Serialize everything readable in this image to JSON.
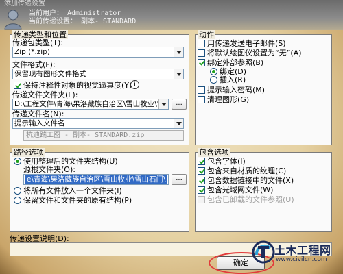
{
  "window": {
    "title": "添加传递设置",
    "user_line": "当前用户：  Administrator",
    "setting_line": "当前传递设置：  副本- STANDARD"
  },
  "transmittal_type": {
    "group_title": "传递类型和位置",
    "package_type_label": "传递包类型(T):",
    "package_type_value": "Zip (*.zip)",
    "file_format_label": "文件格式(F):",
    "file_format_value": "保留现有图形文件格式",
    "keep_visual_fidelity_label": "保持注释性对象的视觉逼真度(Y)",
    "folder_label": "传递文件文件夹(L):",
    "folder_value": "D:\\工程文件\\青海\\果洛藏族自治区\\雪山牧业\\雪山石",
    "folder_browse": "...",
    "filename_label": "传递文件名(N):",
    "filename_value": "提示输入文件名",
    "filename_preview": "杭迪踹工图 - 副本- STANDARD.zip"
  },
  "actions": {
    "group_title": "动作",
    "items": [
      {
        "label": "用传递发送电子邮件(S)",
        "checked": false
      },
      {
        "label": "将默认绘图仪设置为“无”(A)",
        "checked": false
      },
      {
        "label": "绑定外部参照(B)",
        "checked": true
      },
      {
        "label": "提示输入密码(M)",
        "checked": false
      },
      {
        "label": "清理图形(G)",
        "checked": false
      }
    ],
    "bind_label": "绑定(D)",
    "insert_label": "插入(R)"
  },
  "path_options": {
    "group_title": "路径选项",
    "use_organized_label": "使用整理后的文件夹结构(U)",
    "source_root_label": "源根文件夹(O):",
    "source_root_value": "e\\青海\\果洛藏族自治区\\雪山牧业\\雪山石门\\",
    "source_browse": "...",
    "all_in_one_label": "将所有文件放入一个文件夹(I)",
    "keep_structure_label": "保留文件和文件夹的原有结构(P)"
  },
  "include_options": {
    "group_title": "包含选项",
    "items": [
      {
        "label": "包含字体(I)",
        "checked": true,
        "disabled": false
      },
      {
        "label": "包含来自材质的纹理(C)",
        "checked": true,
        "disabled": false
      },
      {
        "label": "包含数据链接中的文件(X)",
        "checked": true,
        "disabled": false
      },
      {
        "label": "包含光域网文件(W)",
        "checked": true,
        "disabled": false
      },
      {
        "label": "包含已卸载的文件参照(U)",
        "checked": false,
        "disabled": true
      }
    ]
  },
  "description": {
    "label": "传递设置说明(D):"
  },
  "buttons": {
    "ok_label": "确定"
  },
  "watermark": {
    "title": "土木工程网",
    "url": "www.civilcn.com"
  },
  "colors": {
    "check_green": "#21a121",
    "selection_blue": "#316ac5",
    "highlight_red": "#e23a3a"
  }
}
